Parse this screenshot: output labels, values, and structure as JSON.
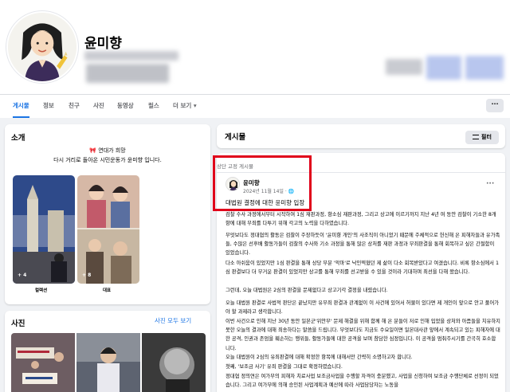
{
  "profile": {
    "name": "윤미향"
  },
  "tabs": [
    "게시물",
    "정보",
    "친구",
    "사진",
    "동영상",
    "릴스",
    "더 보기 ▾"
  ],
  "tabs_more_label": "···",
  "intro": {
    "title": "소개",
    "line1": "🎀 연대가 희망",
    "line2": "다시 거리로 돌아온 시민운동가 윤미향 입니다.",
    "featured": [
      "컬렉션",
      "대표"
    ]
  },
  "photos": {
    "title": "사진",
    "see_all": "사진 모두 보기"
  },
  "posts": {
    "title": "게시물",
    "filter_label": "필터",
    "filter_icon": "sliders-icon",
    "pinned_label": "상단 고정 게시물",
    "author": "윤미향",
    "date": "2024년 11월 14일 · 🌐",
    "menu_label": "···",
    "headline": "대법원 결정에 대한 윤미향 입장",
    "paragraphs": [
      "검찰 수사 과정에서부터 시작하여 1심 재판과정, 항소심 재판과정, 그리고 상고에 이르기까지 지난 4년 여 동안 검찰이 기소한 8개 항에 대해 무죄를 다투기 위해 각고의 노력을 다하였습니다.",
      "무엇보다도 정대협의 활동은 검찰이 주장하듯이 '윤미향 개인'의 사조직이 아니었기 때문에 주체적으로 헌신해 온 피해자들과 유가족들, 수많은 선후배 활동가들이 검찰의 수사와 기소 과정을 통해 많은 상처를 재판 과정과 무죄판결을 통해 회복하고 싶은 간절함이 있었습니다.",
      "다소 아쉬움이 있었지만 1심 판결을 통해 상당 부분 '악마'로 낙인찍혔던 제 삶이 다소 회복받았다고 여겼습니다. 비록 항소심에서 1심 판결보다 더 무거운 판결이 있었지만 상고를 통해 무죄를 선고받을 수 있을 것이라 기대하며 최선을 다해 왔습니다.",
      "그런데, 오늘 대법원은 2심의 판결을 문제없다고 상고기각 결정을 내렸습니다.",
      "오늘 대법원 판결로 사법적 판단은 끝났지만 유무죄 판결과 관계없이 이 사건에 있어서 허물이 있다면 제 개인이 앞으로 안고 풀어가야 할 과제라고 생각합니다.",
      "이번 사건으로 인해 지난 30년 동안 일본군'위안부' 문제 해결을 위해 함께 해 온 분들이 저로 인해 입었을 상처와 아픔들을 치유하지 못한 오늘의 결과에 대해 죄송하다는 말씀을 드립니다. 무엇보다도 지금도 수요일이면 일본대사관 앞에서 계속되고 있는 피해자에 대한 공격, 인권과 존엄을 훼손하는 행위들, 활동가들에 대한 공격을 보며 참담한 심정입니다. 이 공격을 멈춰주시기를 간곡히 호소합니다.",
      "오늘 대법원이 2심의 유죄판결에 대해 확정한 항목에 대해서만 간략히 소명하고자 합니다.",
      "첫째, '보조금 사기' 유죄 판결을 그대로 확정하였습니다.",
      "정대협 정의연은 여가부의 피해자 치료사업 보조금사업을 수행할 자격이 충분했고, 사업을 신청하여 보조금 수행단체로 선정이 되었습니다. 그리고 여가부에 의해 승인된 사업계획과 예산에 따라 사업담당자는 노동을"
    ]
  }
}
